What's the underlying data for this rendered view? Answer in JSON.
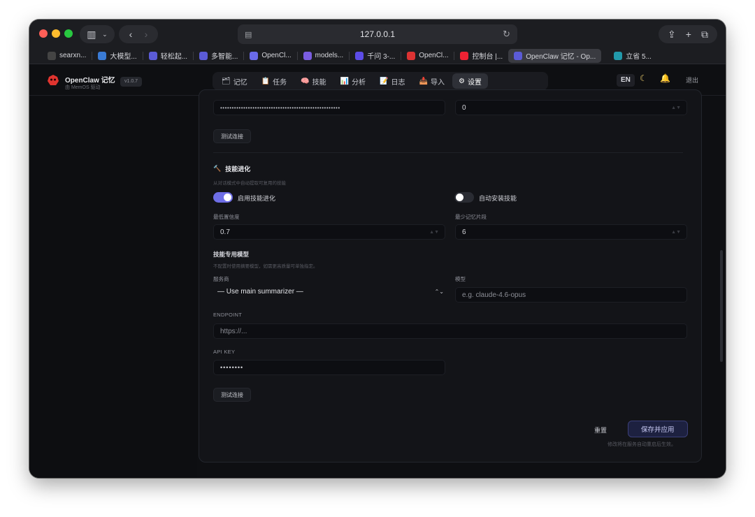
{
  "browser": {
    "url": "127.0.0.1",
    "tabs": [
      {
        "label": "searxn...",
        "fav_color": "#444"
      },
      {
        "label": "大模型...",
        "fav_color": "#3a7bd5"
      },
      {
        "label": "轻松起...",
        "fav_color": "#5b5bd6"
      },
      {
        "label": "多智能...",
        "fav_color": "#5b5bd6"
      },
      {
        "label": "OpenCl...",
        "fav_color": "#6a6ae8"
      },
      {
        "label": "models...",
        "fav_color": "#7a5de0"
      },
      {
        "label": "千问 3-...",
        "fav_color": "#5c4ce6"
      },
      {
        "label": "OpenCl...",
        "fav_color": "#d33"
      },
      {
        "label": "控制台 |...",
        "fav_color": "#e23"
      },
      {
        "label": "OpenClaw 记忆 - Op...",
        "fav_color": "#5b5bd6"
      },
      {
        "label": "立省 5...",
        "fav_color": "#29a"
      }
    ]
  },
  "app": {
    "brand": "OpenClaw 记忆",
    "brand_sub": "由 MemOS 驱动",
    "version": "v1.0.7",
    "nav": [
      {
        "icon": "🗂",
        "label": "记忆"
      },
      {
        "icon": "📋",
        "label": "任务"
      },
      {
        "icon": "🧠",
        "label": "技能"
      },
      {
        "icon": "📊",
        "label": "分析"
      },
      {
        "icon": "📝",
        "label": "日志"
      },
      {
        "icon": "📥",
        "label": "导入"
      },
      {
        "icon": "⚙",
        "label": "设置"
      }
    ],
    "lang": "EN",
    "logout": "退出"
  },
  "settings": {
    "top_password_mask": "••••••••••••••••••••••••••••••••••••••••••••••••••••",
    "top_number": "0",
    "test_conn": "测试连接",
    "skill_section": {
      "title": "技能进化",
      "icon": "🔨",
      "desc": "从对话模式中自动提取可复用的技能",
      "enable_label": "启用技能进化",
      "enable_on": true,
      "auto_install_label": "自动安装技能",
      "auto_install_on": false,
      "min_conf_label": "最低置信度",
      "min_conf_value": "0.7",
      "min_mem_label": "最少记忆片段",
      "min_mem_value": "6"
    },
    "model_section": {
      "title": "技能专用模型",
      "desc": "不配置时使用摘要模型，如需更高质量可单独指定。",
      "provider_label": "服务商",
      "provider_value": "— Use main summarizer —",
      "model_label": "模型",
      "model_placeholder": "e.g. claude-4.6-opus",
      "endpoint_label": "ENDPOINT",
      "endpoint_placeholder": "https://...",
      "apikey_label": "API KEY",
      "apikey_mask": "••••••••"
    },
    "reset": "重置",
    "save": "保存并应用",
    "save_note": "修改将在服务自动重启后生效。"
  }
}
